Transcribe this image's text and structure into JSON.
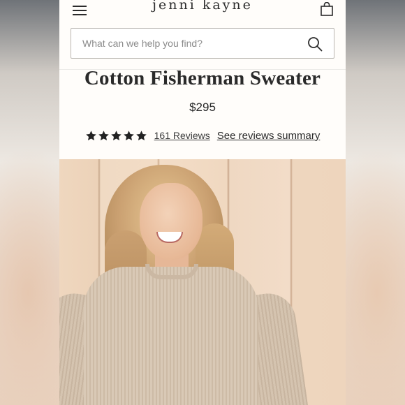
{
  "header": {
    "menu_icon": "hamburger-menu-icon",
    "logo_text": "jenni kayne",
    "bag_icon": "shopping-bag-icon"
  },
  "search": {
    "placeholder": "What can we help you find?",
    "value": "",
    "icon": "search-icon"
  },
  "product": {
    "title": "Cotton Fisherman Sweater",
    "price": "$295",
    "rating": 5,
    "rating_max": 5,
    "reviews_link": "161 Reviews",
    "summary_link": "See reviews summary"
  },
  "hero": {
    "image": "model-in-cotton-fisherman-sweater-photo"
  },
  "colors": {
    "text": "#2a2a2a",
    "background": "#fffdfa",
    "border": "#b9b6b1"
  }
}
